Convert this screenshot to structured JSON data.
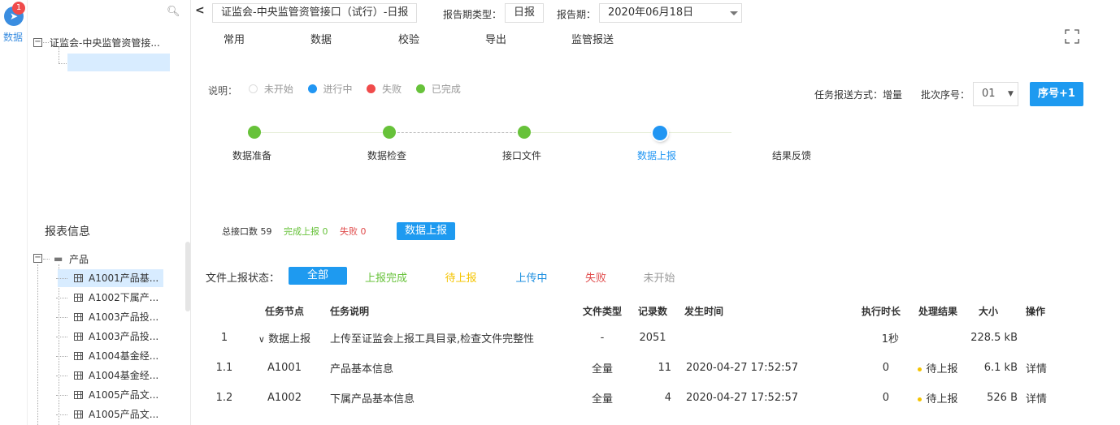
{
  "rail": {
    "badge": "1",
    "label": "数据",
    "icon": "send-icon"
  },
  "tree": {
    "root_label": "证监会-中央监管资管接...",
    "section_title": "报表信息",
    "group_label": "产品",
    "items": [
      "A1001产品基...",
      "A1002下属产...",
      "A1003产品投...",
      "A1003产品投...",
      "A1004基金经...",
      "A1004基金经...",
      "A1005产品文...",
      "A1005产品文..."
    ]
  },
  "topbar": {
    "interface_name": "证监会-中央监管资管接口（试行）-日报",
    "period_type_label": "报告期类型：",
    "period_type_value": "日报",
    "period_label": "报告期：",
    "period_value": "2020年06月18日"
  },
  "menu": [
    "常用",
    "数据",
    "校验",
    "导出",
    "监管报送"
  ],
  "legend": {
    "title": "说明：",
    "items": [
      {
        "label": "未开始",
        "color": "#ffffff"
      },
      {
        "label": "进行中",
        "color": "#2196f3"
      },
      {
        "label": "失败",
        "color": "#f04b4b"
      },
      {
        "label": "已完成",
        "color": "#67c23a"
      }
    ]
  },
  "task": {
    "mode_label": "任务报送方式：增量",
    "batch_label": "批次序号：",
    "batch_value": "01",
    "seq_button": "序号+1"
  },
  "steps": [
    "数据准备",
    "数据检查",
    "接口文件",
    "数据上报",
    "结果反馈"
  ],
  "summary": {
    "total": "总接口数 59",
    "done": "完成上报 0",
    "failed": "失败 0",
    "upload_button": "数据上报"
  },
  "filters": {
    "label": "文件上报状态：",
    "items": [
      {
        "label": "全部",
        "color": "#ffffff"
      },
      {
        "label": "上报完成",
        "color": "#67c23a"
      },
      {
        "label": "待上报",
        "color": "#f5c400"
      },
      {
        "label": "上传中",
        "color": "#1e8fe0"
      },
      {
        "label": "失败",
        "color": "#e04b4b"
      },
      {
        "label": "未开始",
        "color": "#999999"
      }
    ]
  },
  "table": {
    "headers": [
      "任务节点",
      "任务说明",
      "文件类型",
      "记录数",
      "发生时间",
      "执行时长",
      "处理结果",
      "大小",
      "操作"
    ],
    "rows": [
      {
        "no": "1",
        "node": "数据上报",
        "desc": "上传至证监会上报工具目录,检查文件完整性",
        "type": "-",
        "count": "2051",
        "time": "",
        "duration": "1秒",
        "result": "",
        "size": "228.5 kB",
        "action": ""
      },
      {
        "no": "1.1",
        "node": "A1001",
        "desc": "产品基本信息",
        "type": "全量",
        "count": "11",
        "time": "2020-04-27 17:52:57",
        "duration": "0",
        "result": "待上报",
        "size": "6.1 kB",
        "action": "详情"
      },
      {
        "no": "1.2",
        "node": "A1002",
        "desc": "下属产品基本信息",
        "type": "全量",
        "count": "4",
        "time": "2020-04-27 17:52:57",
        "duration": "0",
        "result": "待上报",
        "size": "526 B",
        "action": "详情"
      }
    ]
  }
}
